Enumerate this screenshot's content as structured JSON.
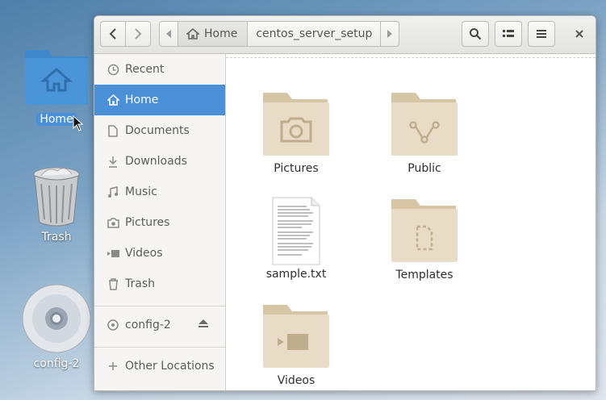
{
  "desktop": {
    "icons": [
      {
        "label": "Home",
        "icon": "home-folder-icon"
      },
      {
        "label": "Trash",
        "icon": "trash-icon"
      },
      {
        "label": "config-2",
        "icon": "optical-disc-icon"
      }
    ]
  },
  "headerbar": {
    "path": [
      {
        "label": "Home",
        "icon": "home-icon"
      },
      {
        "label": "centos_server_setup"
      }
    ],
    "icons": {
      "back": "chevron-left-icon",
      "forward": "chevron-right-icon",
      "search": "search-icon",
      "view": "list-view-icon",
      "menu": "hamburger-menu-icon",
      "close": "close-icon"
    }
  },
  "sidebar": {
    "items": [
      {
        "label": "Recent",
        "icon": "clock-icon"
      },
      {
        "label": "Home",
        "icon": "home-icon",
        "active": true
      },
      {
        "label": "Documents",
        "icon": "document-icon"
      },
      {
        "label": "Downloads",
        "icon": "download-icon"
      },
      {
        "label": "Music",
        "icon": "music-icon"
      },
      {
        "label": "Pictures",
        "icon": "camera-icon"
      },
      {
        "label": "Videos",
        "icon": "video-icon"
      },
      {
        "label": "Trash",
        "icon": "trash-icon"
      }
    ],
    "devices": [
      {
        "label": "config-2",
        "icon": "disc-icon",
        "action_icon": "eject-icon"
      }
    ],
    "other": {
      "label": "Other Locations",
      "icon": "plus-icon"
    }
  },
  "content": {
    "items": [
      {
        "label": "Pictures",
        "icon": "camera-folder-icon"
      },
      {
        "label": "Public",
        "icon": "share-folder-icon"
      },
      {
        "label": "sample.txt",
        "icon": "text-file-icon"
      },
      {
        "label": "Templates",
        "icon": "template-folder-icon"
      },
      {
        "label": "Videos",
        "icon": "video-folder-icon"
      }
    ]
  },
  "colors": {
    "selection": "#4a90d9",
    "folder": "#e8dcc6",
    "folder_tab": "#d6c6a6",
    "folder_glyph": "#bfae8e"
  }
}
